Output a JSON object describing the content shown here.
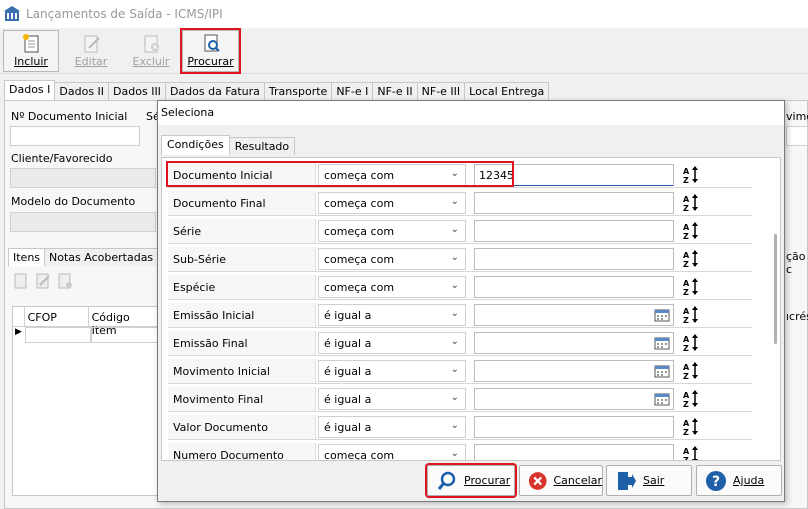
{
  "window": {
    "title": "Lançamentos de Saída - ICMS/IPI"
  },
  "toolbar": {
    "incluir": "Incluir",
    "editar": "Editar",
    "excluir": "Excluir",
    "procurar": "Procurar"
  },
  "main_tabs": [
    "Dados I",
    "Dados II",
    "Dados III",
    "Dados da Fatura",
    "Transporte",
    "NF-e I",
    "NF-e II",
    "NF-e III",
    "Local Entrega"
  ],
  "form": {
    "doc_inicial_label": "Nº Documento Inicial",
    "se_label": "Sé",
    "cliente_label": "Cliente/Favorecido",
    "modelo_label": "Modelo do Documento",
    "right_label": "vime",
    "right_label2": "ção c",
    "right_label3": "ıcrésc"
  },
  "items_tabs": [
    "Itens",
    "Notas Acobertadas"
  ],
  "grid": {
    "columns": [
      "CFOP",
      "Código Item"
    ]
  },
  "dialog": {
    "title": "Seleciona",
    "tabs": [
      "Condições",
      "Resultado"
    ],
    "rows": [
      {
        "field": "Documento Inicial",
        "op": "começa com",
        "value": "12345",
        "calendar": false
      },
      {
        "field": "Documento Final",
        "op": "começa com",
        "value": "",
        "calendar": false
      },
      {
        "field": "Série",
        "op": "começa com",
        "value": "",
        "calendar": false
      },
      {
        "field": "Sub-Série",
        "op": "começa com",
        "value": "",
        "calendar": false
      },
      {
        "field": "Espécie",
        "op": "começa com",
        "value": "",
        "calendar": false
      },
      {
        "field": "Emissão Inicial",
        "op": "é igual a",
        "value": "",
        "calendar": true
      },
      {
        "field": "Emissão Final",
        "op": "é igual a",
        "value": "",
        "calendar": true
      },
      {
        "field": "Movimento Inicial",
        "op": "é igual a",
        "value": "",
        "calendar": true
      },
      {
        "field": "Movimento Final",
        "op": "é igual a",
        "value": "",
        "calendar": true
      },
      {
        "field": "Valor Documento",
        "op": "é igual a",
        "value": "",
        "calendar": false
      },
      {
        "field": "Numero Documento",
        "op": "começa com",
        "value": "",
        "calendar": false
      }
    ],
    "buttons": {
      "procurar": "Procurar",
      "cancelar": "Cancelar",
      "sair": "Sair",
      "ajuda": "Ajuda"
    }
  },
  "colors": {
    "highlight": "#e0141e",
    "accent": "#1f5fa8"
  }
}
